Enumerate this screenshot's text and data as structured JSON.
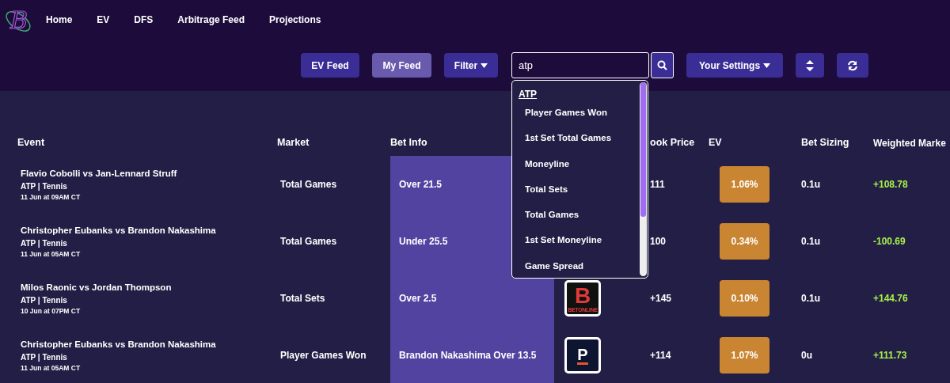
{
  "nav": {
    "logo_letter": "B",
    "items": [
      "Home",
      "EV",
      "DFS",
      "Arbitrage Feed",
      "Projections"
    ]
  },
  "toolbar": [
    {
      "kind": "feed",
      "label": "EV Feed",
      "selected": false
    },
    {
      "kind": "feed",
      "label": "My Feed",
      "selected": true
    },
    {
      "kind": "dropdown",
      "label": "Filter"
    },
    {
      "kind": "search",
      "value": "atp"
    },
    {
      "kind": "dropdown",
      "label": "Your Settings"
    },
    {
      "kind": "sort"
    },
    {
      "kind": "refresh"
    }
  ],
  "search_dropdown": {
    "group": "ATP",
    "items": [
      "Player Games Won",
      "1st Set Total Games",
      "Moneyline",
      "Total Sets",
      "Total Games",
      "1st Set Moneyline",
      "Game Spread"
    ]
  },
  "table": {
    "columns": [
      "Event",
      "Market",
      "Bet Info",
      "ook Price",
      "EV",
      "Bet Sizing",
      "Weighted Marke"
    ],
    "rows": [
      {
        "event": "Flavio Cobolli vs Jan-Lennard Struff",
        "league": "ATP | Tennis",
        "date": "11 Jun at 09AM CT",
        "market": "Total Games",
        "bet_info": "Over 21.5",
        "price": "111",
        "ev": "1.06%",
        "bet_sizing": "0.1u",
        "weighted": "+108.78"
      },
      {
        "event": "Christopher Eubanks vs Brandon Nakashima",
        "league": "ATP | Tennis",
        "date": "11 Jun at 05AM CT",
        "market": "Total Games",
        "bet_info": "Under 25.5",
        "price": "100",
        "ev": "0.34%",
        "bet_sizing": "0.1u",
        "weighted": "-100.69"
      },
      {
        "event": "Milos Raonic vs Jordan Thompson",
        "league": "ATP | Tennis",
        "date": "10 Jun at 07PM CT",
        "market": "Total Sets",
        "bet_info": "Over 2.5",
        "sportsbook": {
          "kind": "betonline",
          "letter": "B",
          "caption": "BETONLINE"
        },
        "price": "+145",
        "ev": "0.10%",
        "bet_sizing": "0.1u",
        "weighted": "+144.76"
      },
      {
        "event": "Christopher Eubanks vs Brandon Nakashima",
        "league": "ATP | Tennis",
        "date": "11 Jun at 05AM CT",
        "market": "Player Games Won",
        "bet_info": "Brandon Nakashima Over 13.5",
        "sportsbook": {
          "kind": "p",
          "letter": "P"
        },
        "price": "+114",
        "ev": "1.07%",
        "bet_sizing": "0u",
        "weighted": "+111.73"
      }
    ]
  }
}
